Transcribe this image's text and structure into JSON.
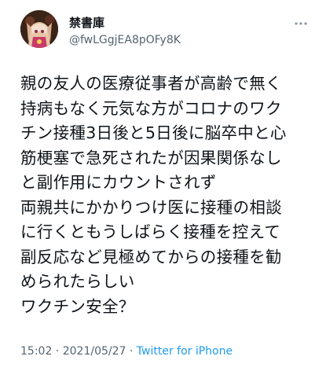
{
  "tweet": {
    "display_name": "禁書庫",
    "handle": "@fwLGgjEA8pOFy8K",
    "more_icon": "more-dots-icon",
    "avatar_icon": "avatar-image",
    "text_lines": [
      "親の友人の医療従事者が高齢で無く",
      "持病もなく元気な方がコロナのワク",
      "チン接種3日後と5日後に脳卒中と心",
      "筋梗塞で急死されたが因果関係なし",
      "と副作用にカウントされず",
      "両親共にかかりつけ医に接種の相談",
      "に行くともうしばらく接種を控えて",
      "副反応など見極めてからの接種を勧",
      "められたらしい",
      "ワクチン安全？"
    ],
    "time": "15:02",
    "separator1": " · ",
    "date": "2021/05/27",
    "separator2": " · ",
    "source": "Twitter for iPhone"
  },
  "colors": {
    "text": "#0f1419",
    "secondary": "#536471",
    "link": "#1d9bf0"
  }
}
